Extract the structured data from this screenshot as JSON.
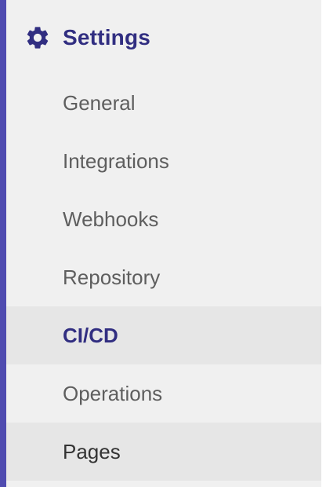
{
  "settings": {
    "title": "Settings",
    "icon": "gear-icon",
    "accent_color": "#4f4bb0",
    "title_color": "#312e81"
  },
  "menu": {
    "items": [
      {
        "label": "General",
        "state": "default"
      },
      {
        "label": "Integrations",
        "state": "default"
      },
      {
        "label": "Webhooks",
        "state": "default"
      },
      {
        "label": "Repository",
        "state": "default"
      },
      {
        "label": "CI/CD",
        "state": "active"
      },
      {
        "label": "Operations",
        "state": "default"
      },
      {
        "label": "Pages",
        "state": "hover"
      }
    ]
  }
}
